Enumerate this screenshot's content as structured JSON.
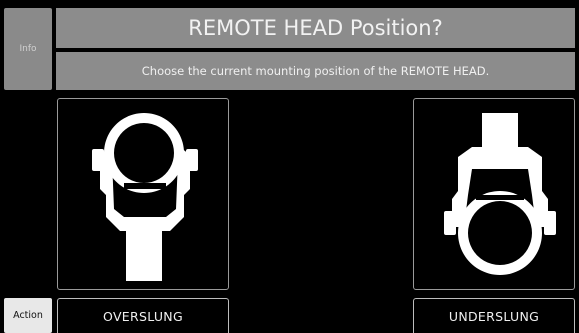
{
  "sidebar": {
    "info_label": "Info",
    "action_label": "Action"
  },
  "header": {
    "title": "REMOTE HEAD Position?",
    "subtitle": "Choose the current mounting position of the REMOTE HEAD."
  },
  "options": {
    "overslung_label": "OVERSLUNG",
    "underslung_label": "UNDERSLUNG"
  }
}
